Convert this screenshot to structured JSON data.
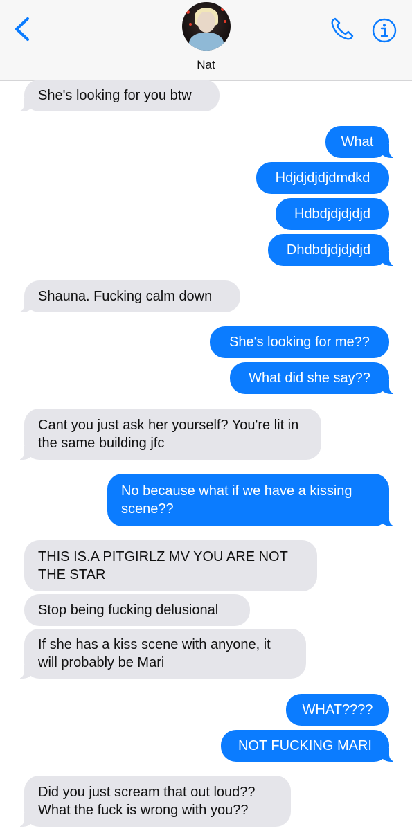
{
  "header": {
    "contact_name": "Nat",
    "back_icon": "chevron-left-icon",
    "phone_icon": "phone-icon",
    "info_icon": "info-icon",
    "accent_color": "#0b7cff"
  },
  "messages": [
    {
      "direction": "in",
      "text": "She's looking for you btw"
    },
    {
      "direction": "out",
      "text": "What"
    },
    {
      "direction": "out",
      "text": "Hdjdjdjdjdmdkd"
    },
    {
      "direction": "out",
      "text": "Hdbdjdjdjdjd"
    },
    {
      "direction": "out",
      "text": "Dhdbdjdjdjdjd"
    },
    {
      "direction": "in",
      "text": "Shauna. Fucking calm down"
    },
    {
      "direction": "out",
      "text": "She's looking for me??"
    },
    {
      "direction": "out",
      "text": "What did she say??"
    },
    {
      "direction": "in",
      "text": "Cant you just ask her yourself? You're lit in the same building jfc"
    },
    {
      "direction": "out",
      "text": "No because what if we have a kissing scene??"
    },
    {
      "direction": "in",
      "text": "THIS IS.A PITGIRLZ MV YOU ARE NOT THE STAR"
    },
    {
      "direction": "in",
      "text": "Stop being fucking delusional"
    },
    {
      "direction": "in",
      "text": "If she has a kiss scene with anyone, it will probably be Mari"
    },
    {
      "direction": "out",
      "text": "WHAT????"
    },
    {
      "direction": "out",
      "text": "NOT FUCKING MARI"
    },
    {
      "direction": "in",
      "text": "Did you just scream that out loud?? What the fuck is wrong with you??"
    }
  ]
}
